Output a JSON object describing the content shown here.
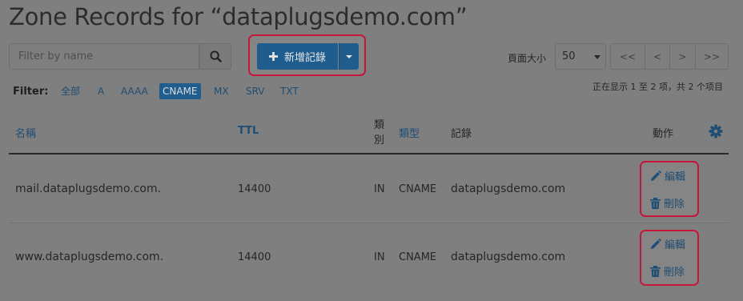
{
  "page": {
    "title": "Zone Records for “dataplugsdemo.com”"
  },
  "toolbar": {
    "search_placeholder": "Filter by name",
    "add_record_label": "新增記錄",
    "page_size_label": "頁面大小",
    "page_size_value": "50",
    "pager": {
      "first": "<<",
      "prev": "<",
      "next": ">",
      "last": ">>"
    }
  },
  "filter": {
    "label": "Filter:",
    "chips": [
      "全部",
      "A",
      "AAAA",
      "CNAME",
      "MX",
      "SRV",
      "TXT"
    ],
    "active": "CNAME"
  },
  "count_text": "正在显示 1 至 2 项，共 2 个项目",
  "table": {
    "headers": {
      "name": "名稱",
      "ttl": "TTL",
      "class": "類別",
      "type": "類型",
      "record": "記錄",
      "actions": "動作"
    },
    "rows": [
      {
        "name": "mail.dataplugsdemo.com.",
        "ttl": "14400",
        "class": "IN",
        "type": "CNAME",
        "record": "dataplugsdemo.com",
        "edit": "編輯",
        "delete": "刪除"
      },
      {
        "name": "www.dataplugsdemo.com.",
        "ttl": "14400",
        "class": "IN",
        "type": "CNAME",
        "record": "dataplugsdemo.com",
        "edit": "編輯",
        "delete": "刪除"
      }
    ]
  },
  "colors": {
    "background": "#7f7f7f",
    "primary": "#1f5d8f",
    "link": "#1f4d73",
    "highlight": "#c4173a"
  },
  "icons": [
    "search-icon",
    "plus-icon",
    "caret-down-icon",
    "gear-icon",
    "pencil-icon",
    "trash-icon"
  ]
}
